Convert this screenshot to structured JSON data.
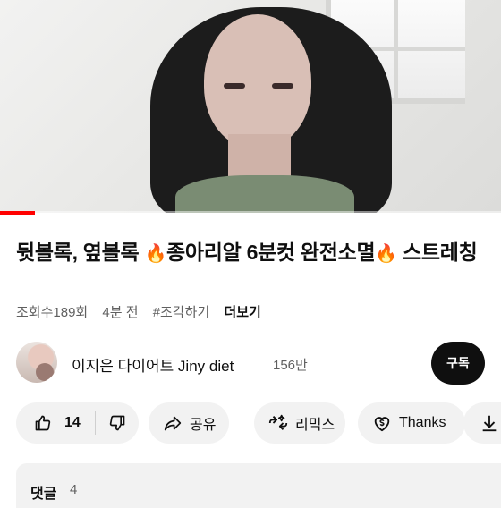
{
  "video": {
    "progress_fraction": 0.07
  },
  "title": {
    "part1": "뒷볼록, 옆볼록",
    "emoji1": "🔥",
    "part2": "종아리알 6분컷 완전소멸",
    "emoji2": "🔥",
    "part3": "스트레칭"
  },
  "meta": {
    "views": "조회수189회",
    "age": "4분 전",
    "hashtag": "#조각하기",
    "more": "더보기"
  },
  "channel": {
    "name": "이지은 다이어트 Jiny diet",
    "subscribers": "156만",
    "subscribe_label": "구독"
  },
  "actions": {
    "like_count": "14",
    "share_label": "공유",
    "remix_label": "리믹스",
    "thanks_label": "Thanks"
  },
  "comments": {
    "label": "댓글",
    "count": "4"
  },
  "colors": {
    "progress": "#ff0000",
    "chip_bg": "#f2f2f2",
    "subscribe_bg": "#0f0f0f"
  }
}
